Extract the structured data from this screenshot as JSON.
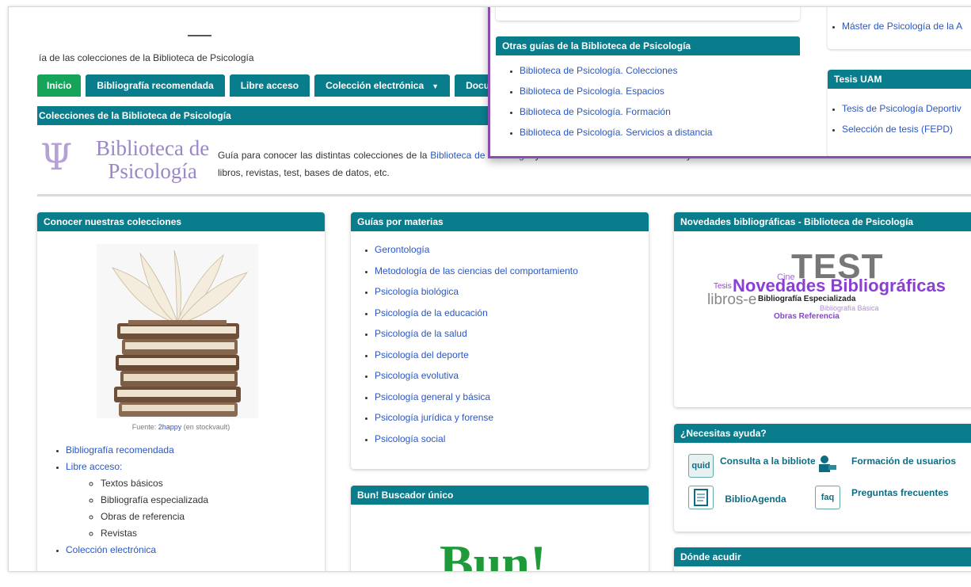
{
  "site": {
    "title": "Biblioteca de Psicología",
    "subtitle": "ía de las colecciones de la Biblioteca de Psicología"
  },
  "nav": {
    "tabs": [
      {
        "label": "Inicio"
      },
      {
        "label": "Bibliografía recomendada"
      },
      {
        "label": "Libre acceso"
      },
      {
        "label": "Colección electrónica"
      },
      {
        "label": "Docum"
      }
    ]
  },
  "crumb": "Colecciones de la Biblioteca de Psicología",
  "logo": {
    "line1": "Biblioteca de",
    "line2": "Psicología"
  },
  "intro": {
    "before": "Guía para conocer las distintas colecciones de la ",
    "link": "Biblioteca de Psicología",
    "after": " y facilitar herramientas de consulta y acceso. Se trata de colecciones tanto físicas con electrónicas de libros, revistas, test, bases de datos, etc."
  },
  "box_colecciones": {
    "title": "Conocer nuestras colecciones",
    "fuente_prefix": "Fuente: ",
    "fuente_link": "2happy",
    "fuente_suffix": " (en stockvault)",
    "items": [
      {
        "label": "Bibliografía recomendada"
      },
      {
        "label": "Libre acceso:"
      },
      {
        "label": "Colección electrónica"
      }
    ],
    "subitems": [
      "Textos básicos",
      "Bibliografía especializada",
      "Obras de referencia",
      "Revistas"
    ]
  },
  "box_materias": {
    "title": "Guías por materias",
    "items": [
      "Gerontología",
      "Metodología de las ciencias del comportamiento",
      "Psicología biológica",
      "Psicología de la educación",
      "Psicología de la salud",
      "Psicología del deporte",
      "Psicología evolutiva",
      "Psicología general y básica",
      "Psicología jurídica y forense",
      "Psicología social"
    ]
  },
  "box_bun": {
    "title": "Bun! Buscador único",
    "logo_text": "Bun!"
  },
  "box_novedades": {
    "title": "Novedades bibliográficas - Biblioteca de Psicología",
    "cloud": {
      "test": "TEST",
      "cine": "Cine",
      "tesis": "Tesis",
      "novedades": "Novedades Bibliográficas",
      "libros": "libros-e",
      "especializada": "Bibliografía Especializada",
      "basica": "Bibliografía Básica",
      "obras": "Obras Referencia"
    }
  },
  "box_ayuda": {
    "title": "¿Necesitas ayuda?",
    "consulta": "Consulta a la biblioteca",
    "formacion": "Formación de usuarios",
    "biblioagenda": "BiblioAgenda",
    "preguntas": "Preguntas frecuentes",
    "quid_icon_text": "quid",
    "faq_icon_text": "faq"
  },
  "box_donde": {
    "title": "Dónde acudir"
  },
  "popup": {
    "otras_title": "Otras guías de la Biblioteca de Psicología",
    "otras_items": [
      "Biblioteca de Psicología. Colecciones",
      "Biblioteca de Psicología. Espacios",
      "Biblioteca de Psicología. Formación",
      "Biblioteca de Psicología. Servicios a distancia"
    ],
    "master_item": "Máster de Psicología de la A",
    "tesis_title": "Tesis UAM",
    "tesis_items": [
      "Tesis de Psicología Deportiv",
      "Selección de tesis (FEPD)"
    ]
  },
  "colors": {
    "teal": "#0a7d8c",
    "active_green": "#16a35a",
    "link": "#2a57c4",
    "popup_border": "#8b4bb0"
  }
}
